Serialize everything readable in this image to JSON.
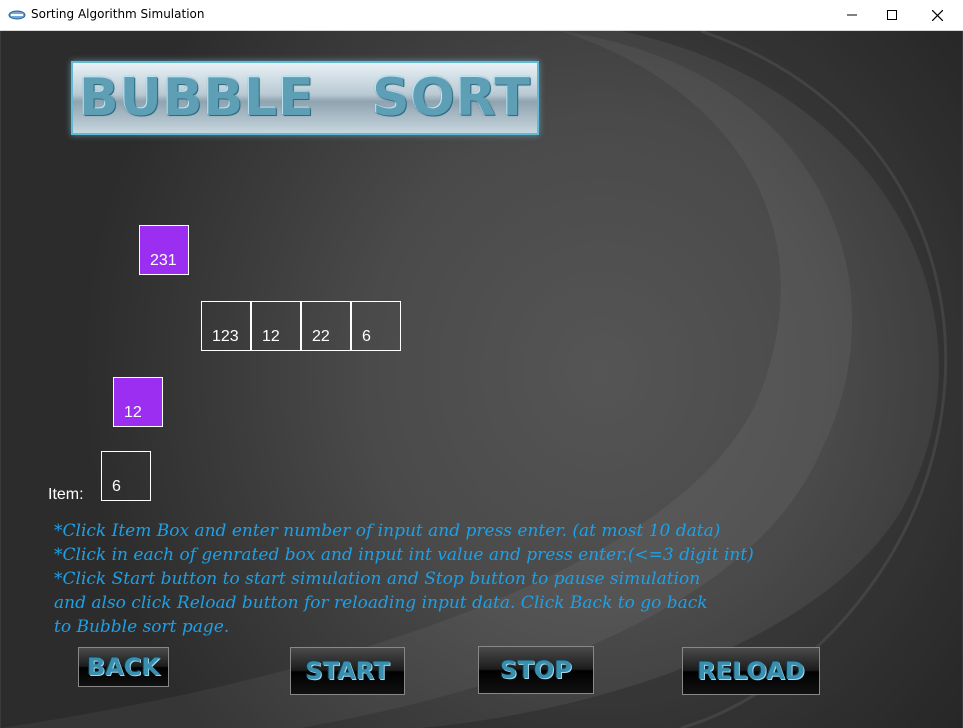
{
  "window": {
    "title": "Sorting Algorithm Simulation",
    "minimize_glyph": "─",
    "maximize_glyph": "☐",
    "close_glyph": "✕"
  },
  "banner": {
    "title": "BUBBLE   SORT"
  },
  "simulation": {
    "moving_top": "231",
    "array": [
      "123",
      "12",
      "22",
      "6"
    ],
    "moving_bottom": "12",
    "item_label": "Item:",
    "item_count": "6",
    "highlight_color": "#9b2ef0"
  },
  "instructions": [
    "*Click Item Box and enter number of input and press enter.  (at most 10 data)",
    "*Click in each of genrated box and input int value and press enter.(<=3 digit int)",
    "*Click Start button to start simulation and Stop button to pause simulation",
    "and also click Reload button for reloading input data. Click Back to go back",
    "to Bubble sort page."
  ],
  "buttons": {
    "back": "BACK",
    "start": "START",
    "stop": "STOP",
    "reload": "RELOAD"
  },
  "colors": {
    "instruction_text": "#1ea0e6",
    "button_text": "#3a8fae",
    "banner_border": "#62b9d4"
  }
}
